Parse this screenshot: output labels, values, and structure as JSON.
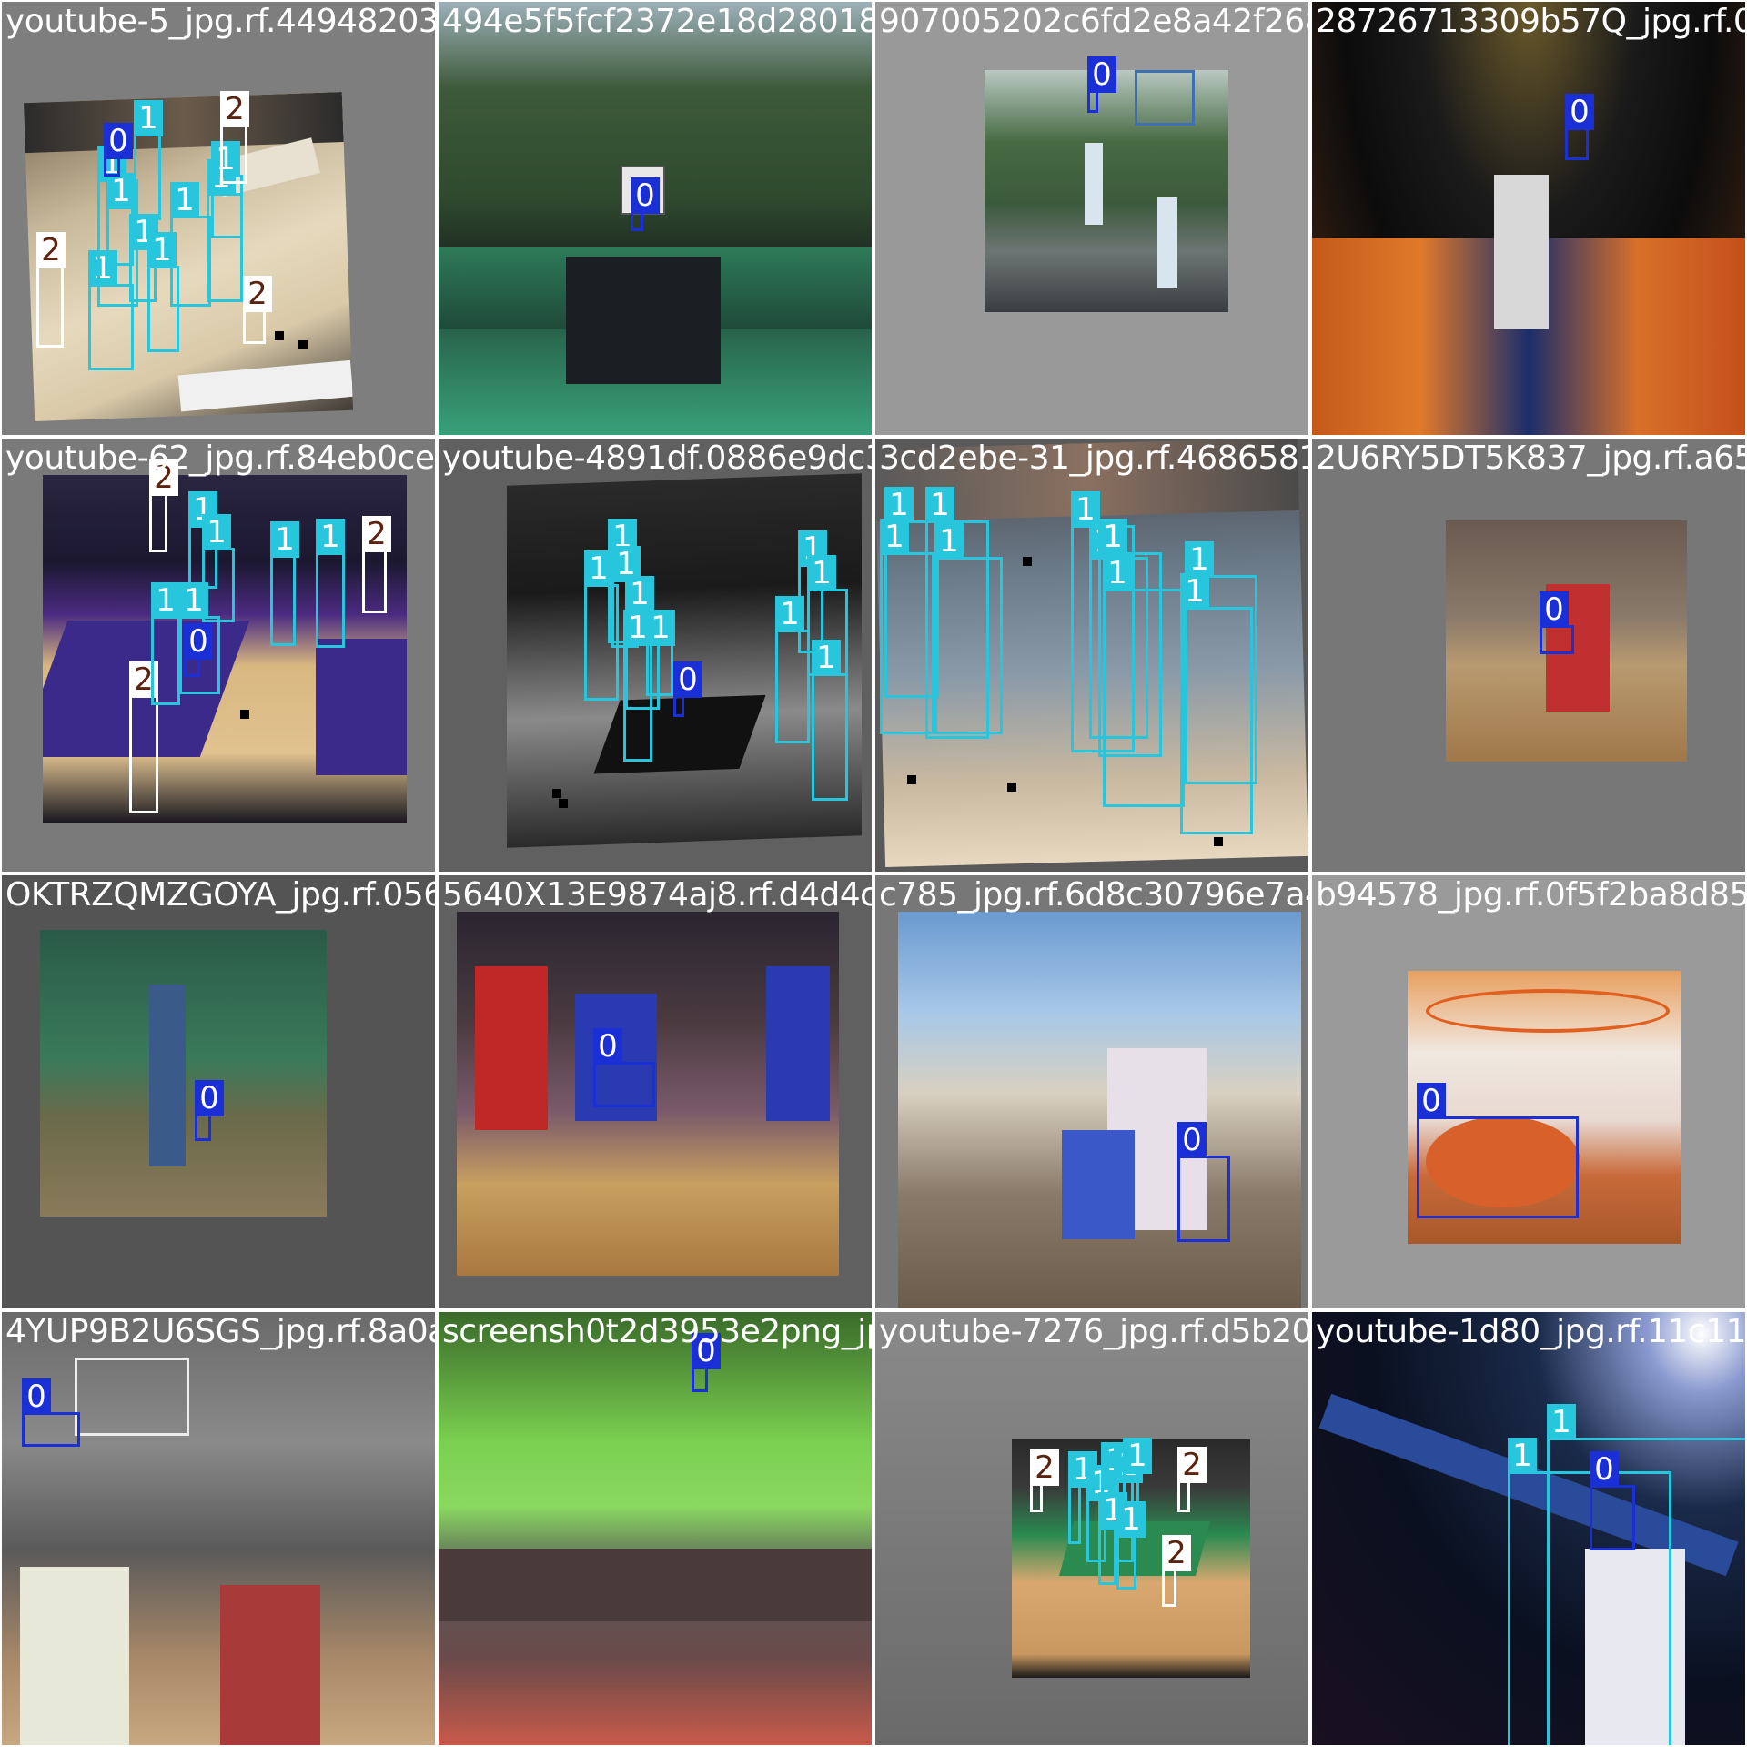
{
  "classes": {
    "0": {
      "label": "0",
      "color": "#1a2fd6",
      "text_color": "#ffffff"
    },
    "1": {
      "label": "1",
      "color": "#27c6dc",
      "text_color": "#ffffff"
    },
    "2": {
      "label": "2",
      "color": "#ffffff",
      "text_color": "#5c2410"
    }
  },
  "tiles": [
    {
      "filename": "youtube-5_jpg.rf.44948203bd494e5f5fcf2372e18d280184907005202c6fd2",
      "scene": "nba-broadcast-court"
    },
    {
      "filename": "494e5f5fcf2372e18d280184907005202c6fd2e8a42f2685cd",
      "scene": "outdoor-court-trees"
    },
    {
      "filename": "907005202c6fd2e8a42f2685cd8726713309b57Q",
      "scene": "outdoor-game-players"
    },
    {
      "filename": "28726713309b57Q_jpg.rf.035",
      "scene": "dunk-orange-team"
    },
    {
      "filename": "youtube-62_jpg.rf.84eb0ceeeyoutube-4891df.0886e9dc",
      "scene": "jazz-arena"
    },
    {
      "filename": "youtube-4891df.0886e9dc3cd2ebe-31_jpg.rf.4686581a",
      "scene": "grayscale-court"
    },
    {
      "filename": "3cd2ebe-31_jpg.rf.4686581a2U6RY5DT5K837",
      "scene": "players-close-celtics"
    },
    {
      "filename": "2U6RY5DT5K837_jpg.rf.a657",
      "scene": "player-dribbling-red"
    },
    {
      "filename": "OKTRZQMZGOYA_jpg.rf.0565640X13E9874aj8.rf.d4d4",
      "scene": "gym-shooter"
    },
    {
      "filename": "5640X13E9874aj8.rf.d4d4c785_jpg.rf.6d8c30",
      "scene": "womens-game"
    },
    {
      "filename": "c785_jpg.rf.6d8c30796e7a4774b94578_jpg.rf.0f5",
      "scene": "outdoor-streetball"
    },
    {
      "filename": "b94578_jpg.rf.0f5f2ba8d855eb",
      "scene": "net-and-ball"
    },
    {
      "filename": "4YUP9B2U6SGS_jpg.rf.8a0ascreensh0t2d3953e2png_jpg.rf",
      "scene": "sixers-game"
    },
    {
      "filename": "screensh0t2d3953e2png_jpg.rf.7604b5e7276_jpg.rf",
      "scene": "gym-green-wall"
    },
    {
      "filename": "youtube-7276_jpg.rf.d5b20ebyoutube-1d80_jpg",
      "scene": "celtics-court-aerial"
    },
    {
      "filename": "youtube-1d80_jpg.rf.11c113b",
      "scene": "night-shot-dark"
    }
  ]
}
